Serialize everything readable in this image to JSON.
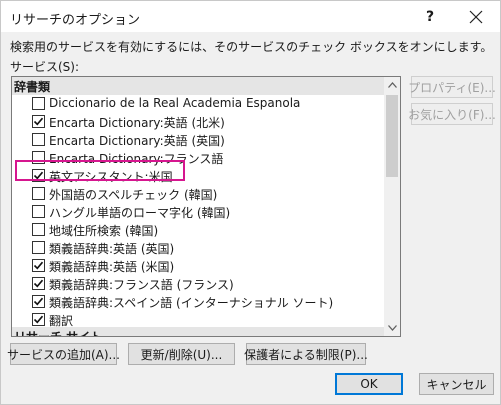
{
  "dialog": {
    "title": "リサーチのオプション",
    "help_label": "?",
    "description": "検索用のサービスを有効にするには、そのサービスのチェック ボックスをオンにします。",
    "services_label": "サービス(S):"
  },
  "list": {
    "group_dictionary": "辞書類",
    "items": [
      {
        "label": "Diccionario de la Real Academia Espanola",
        "checked": false
      },
      {
        "label": "Encarta Dictionary:英語 (北米)",
        "checked": true
      },
      {
        "label": "Encarta Dictionary:英語 (英国)",
        "checked": false
      },
      {
        "label": "Encarta Dictionary:フランス語",
        "checked": false
      },
      {
        "label": "英文アシスタント:米国",
        "checked": true
      },
      {
        "label": "外国語のスペルチェック (韓国)",
        "checked": false
      },
      {
        "label": "ハングル単語のローマ字化 (韓国)",
        "checked": false
      },
      {
        "label": "地域住所検索 (韓国)",
        "checked": false
      },
      {
        "label": "類義語辞典:英語 (英国)",
        "checked": false
      },
      {
        "label": "類義語辞典:英語 (米国)",
        "checked": true
      },
      {
        "label": "類義語辞典:フランス語 (フランス)",
        "checked": true
      },
      {
        "label": "類義語辞典:スペイン語 (インターナショナル ソート)",
        "checked": true
      },
      {
        "label": "翻訳",
        "checked": true
      }
    ],
    "group_research": "リサーチ サイト"
  },
  "buttons": {
    "properties": "プロパティ(E)...",
    "favorites": "お気に入り(F)...",
    "add_service": "サービスの追加(A)...",
    "update_remove": "更新/削除(U)...",
    "parental": "保護者による制限(P)...",
    "ok": "OK",
    "cancel": "キャンセル"
  },
  "colors": {
    "highlight": "#d6168f",
    "accent": "#0078d7"
  }
}
